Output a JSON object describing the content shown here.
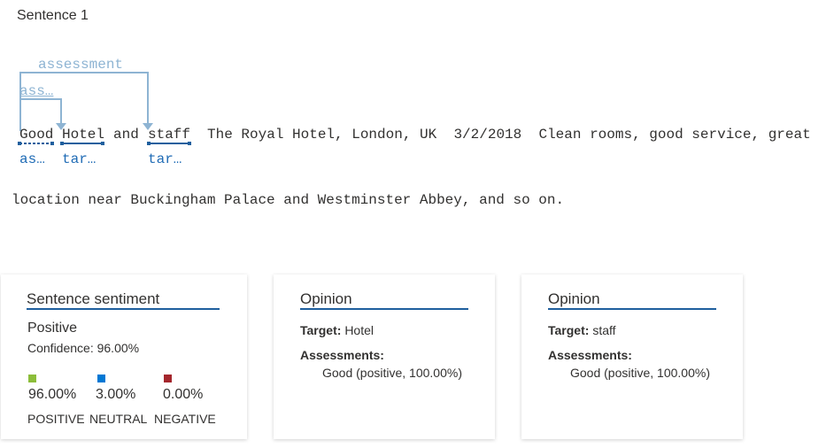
{
  "sentence_label": "Sentence 1",
  "arcs": {
    "long_label": "assessment",
    "short_label": "ass…"
  },
  "tokens": {
    "good": "Good",
    "hotel": "Hotel",
    "and": "and",
    "staff": "staff",
    "rest_line1": "The Royal Hotel, London, UK  3/2/2018  Clean rooms, good service, great",
    "line2": "location near Buckingham Palace and Westminster Abbey, and so on."
  },
  "token_tags": {
    "good": "as…",
    "hotel": "tar…",
    "staff": "tar…"
  },
  "colors": {
    "accent": "#1f5f9e",
    "arc": "#8eb4d3",
    "positive": "#8cbd3a",
    "neutral": "#0078d4",
    "negative": "#a4262c"
  },
  "sentiment_card": {
    "title": "Sentence sentiment",
    "label": "Positive",
    "confidence": "Confidence: 96.00%",
    "scores": [
      {
        "value": "96.00%",
        "label": "POSITIVE",
        "color": "#8cbd3a",
        "fraction": 0.96
      },
      {
        "value": "3.00%",
        "label": "NEUTRAL",
        "color": "#0078d4",
        "fraction": 0.03
      },
      {
        "value": "0.00%",
        "label": "NEGATIVE",
        "color": "#a4262c",
        "fraction": 0.0
      }
    ]
  },
  "opinion_cards": [
    {
      "title": "Opinion",
      "target_label": "Target:",
      "target": "Hotel",
      "assessments_label": "Assessments:",
      "assessment": "Good (positive, 100.00%)"
    },
    {
      "title": "Opinion",
      "target_label": "Target:",
      "target": "staff",
      "assessments_label": "Assessments:",
      "assessment": "Good (positive, 100.00%)"
    }
  ]
}
